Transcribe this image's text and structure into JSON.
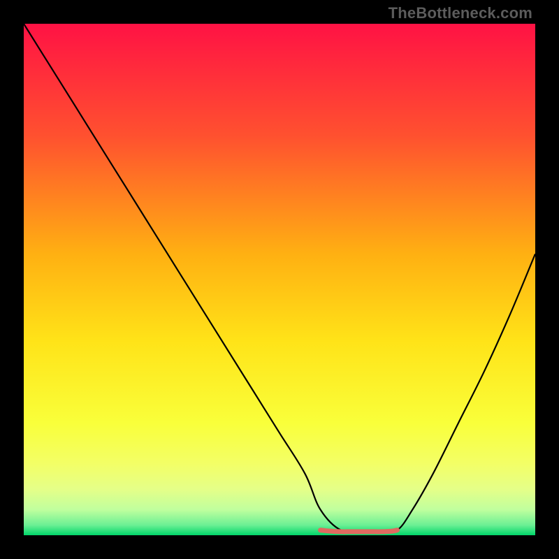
{
  "watermark": "TheBottleneck.com",
  "chart_data": {
    "type": "line",
    "title": "",
    "xlabel": "",
    "ylabel": "",
    "xlim": [
      0,
      100
    ],
    "ylim": [
      0,
      100
    ],
    "grid": false,
    "legend": null,
    "background_gradient": {
      "top_color": "#ff1244",
      "upper_mid_color": "#ff6a2b",
      "mid_color": "#ffd318",
      "lower_mid_color": "#f9ff3a",
      "near_bottom_color": "#d7ff8a",
      "bottom_color": "#00d66a"
    },
    "series": [
      {
        "name": "bottleneck-curve",
        "color": "#000000",
        "x": [
          0,
          5,
          10,
          15,
          20,
          25,
          30,
          35,
          40,
          45,
          50,
          55,
          58,
          62,
          66,
          70,
          73,
          76,
          80,
          85,
          90,
          95,
          100
        ],
        "y": [
          100,
          92,
          84,
          76,
          68,
          60,
          52,
          44,
          36,
          28,
          20,
          12,
          5,
          1,
          1,
          1,
          1,
          5,
          12,
          22,
          32,
          43,
          55
        ]
      },
      {
        "name": "flat-valley-marker",
        "color": "#e06a60",
        "x": [
          58,
          60,
          62,
          64,
          66,
          68,
          70,
          72,
          73
        ],
        "y": [
          1.0,
          0.8,
          0.7,
          0.7,
          0.7,
          0.7,
          0.7,
          0.8,
          1.0
        ]
      }
    ],
    "annotations": []
  }
}
